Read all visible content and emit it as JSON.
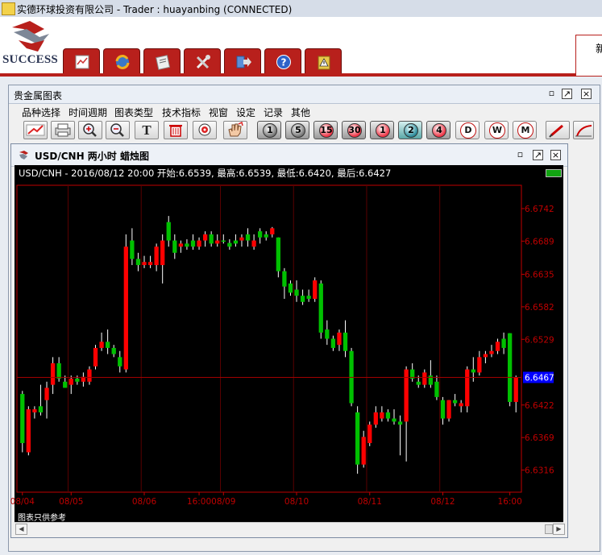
{
  "app": {
    "title": "实德环球投资有限公司 -  Trader : huayanbing (CONNECTED)",
    "logo_text": "SUCCESS",
    "right_box_text": "新"
  },
  "main_tabs": [
    {
      "icon": "chart-doc-icon"
    },
    {
      "icon": "refresh-globe-icon"
    },
    {
      "icon": "notes-icon"
    },
    {
      "icon": "tools-icon"
    },
    {
      "icon": "exit-icon"
    },
    {
      "icon": "help-icon"
    },
    {
      "icon": "clipboard-alert-icon"
    }
  ],
  "chart_window": {
    "title": "贵金属图表",
    "menu": [
      "品种选择",
      "时间週期",
      "图表类型",
      "技术指标",
      "视窗",
      "设定",
      "记录",
      "其他"
    ],
    "toolbar": [
      {
        "icon": "drawing-line-icon"
      },
      {
        "icon": "print-icon"
      },
      {
        "icon": "zoom-in-icon"
      },
      {
        "icon": "zoom-out-icon"
      },
      {
        "icon": "text-tool-icon",
        "glyph": "T"
      },
      {
        "icon": "delete-icon"
      },
      {
        "icon": "target-icon"
      },
      {
        "icon": "hand-icon"
      }
    ],
    "periods": [
      "1",
      "5",
      "15",
      "30",
      "1",
      "2",
      "4",
      "D",
      "W",
      "M"
    ]
  },
  "sub_window": {
    "title": "USD/CNH 两小时 蜡烛图",
    "info": "USD/CNH - 2016/08/12 20:00 开始:6.6539, 最高:6.6539, 最低:6.6420, 最后:6.6427",
    "disclaimer": "图表只供参考"
  },
  "colors": {
    "up": "#ff0000",
    "down": "#00c000",
    "axis": "#c00000",
    "grid": "#5a0000",
    "current_bg": "#0000ff",
    "accent": "#b8201c"
  },
  "chart_data": {
    "type": "candlestick",
    "symbol": "USD/CNH",
    "ylim": [
      6.628,
      6.678
    ],
    "yticks": [
      6.6742,
      6.6689,
      6.6635,
      6.6582,
      6.6529,
      6.6467,
      6.6422,
      6.6369,
      6.6316
    ],
    "current_price": 6.6467,
    "xticks": [
      "08/04",
      "08/05",
      "08/06",
      "16:00",
      "08/09",
      "08/10",
      "08/11",
      "08/12",
      "16:00"
    ],
    "candles": [
      {
        "o": 6.644,
        "h": 6.6445,
        "l": 6.6345,
        "c": 6.636
      },
      {
        "o": 6.6345,
        "h": 6.642,
        "l": 6.634,
        "c": 6.6415
      },
      {
        "o": 6.641,
        "h": 6.642,
        "l": 6.64,
        "c": 6.6415
      },
      {
        "o": 6.642,
        "h": 6.6455,
        "l": 6.6405,
        "c": 6.641
      },
      {
        "o": 6.643,
        "h": 6.646,
        "l": 6.64,
        "c": 6.645
      },
      {
        "o": 6.6455,
        "h": 6.65,
        "l": 6.644,
        "c": 6.649
      },
      {
        "o": 6.649,
        "h": 6.65,
        "l": 6.646,
        "c": 6.6465
      },
      {
        "o": 6.646,
        "h": 6.647,
        "l": 6.645,
        "c": 6.645
      },
      {
        "o": 6.6455,
        "h": 6.647,
        "l": 6.644,
        "c": 6.6465
      },
      {
        "o": 6.6465,
        "h": 6.647,
        "l": 6.6455,
        "c": 6.646
      },
      {
        "o": 6.646,
        "h": 6.6475,
        "l": 6.6452,
        "c": 6.6468
      },
      {
        "o": 6.646,
        "h": 6.6485,
        "l": 6.6455,
        "c": 6.648
      },
      {
        "o": 6.6485,
        "h": 6.652,
        "l": 6.648,
        "c": 6.6515
      },
      {
        "o": 6.6515,
        "h": 6.654,
        "l": 6.651,
        "c": 6.6525
      },
      {
        "o": 6.6525,
        "h": 6.6545,
        "l": 6.6505,
        "c": 6.6515
      },
      {
        "o": 6.6515,
        "h": 6.652,
        "l": 6.65,
        "c": 6.6505
      },
      {
        "o": 6.65,
        "h": 6.651,
        "l": 6.6475,
        "c": 6.6485
      },
      {
        "o": 6.648,
        "h": 6.67,
        "l": 6.6475,
        "c": 6.668
      },
      {
        "o": 6.669,
        "h": 6.671,
        "l": 6.665,
        "c": 6.666
      },
      {
        "o": 6.666,
        "h": 6.667,
        "l": 6.664,
        "c": 6.665
      },
      {
        "o": 6.665,
        "h": 6.6665,
        "l": 6.6645,
        "c": 6.6655
      },
      {
        "o": 6.665,
        "h": 6.6665,
        "l": 6.6645,
        "c": 6.6655
      },
      {
        "o": 6.665,
        "h": 6.6685,
        "l": 6.664,
        "c": 6.668
      },
      {
        "o": 6.665,
        "h": 6.67,
        "l": 6.662,
        "c": 6.669
      },
      {
        "o": 6.672,
        "h": 6.673,
        "l": 6.668,
        "c": 6.669
      },
      {
        "o": 6.669,
        "h": 6.67,
        "l": 6.666,
        "c": 6.667
      },
      {
        "o": 6.668,
        "h": 6.669,
        "l": 6.667,
        "c": 6.6685
      },
      {
        "o": 6.6685,
        "h": 6.6692,
        "l": 6.6675,
        "c": 6.668
      },
      {
        "o": 6.669,
        "h": 6.67,
        "l": 6.6675,
        "c": 6.668
      },
      {
        "o": 6.668,
        "h": 6.6695,
        "l": 6.6675,
        "c": 6.669
      },
      {
        "o": 6.669,
        "h": 6.6705,
        "l": 6.668,
        "c": 6.67
      },
      {
        "o": 6.67,
        "h": 6.6705,
        "l": 6.668,
        "c": 6.6685
      },
      {
        "o": 6.6685,
        "h": 6.67,
        "l": 6.668,
        "c": 6.669
      },
      {
        "o": 6.669,
        "h": 6.67,
        "l": 6.6685,
        "c": 6.6688
      },
      {
        "o": 6.6686,
        "h": 6.6692,
        "l": 6.6675,
        "c": 6.668
      },
      {
        "o": 6.669,
        "h": 6.67,
        "l": 6.668,
        "c": 6.6685
      },
      {
        "o": 6.669,
        "h": 6.67,
        "l": 6.668,
        "c": 6.6695
      },
      {
        "o": 6.67,
        "h": 6.671,
        "l": 6.668,
        "c": 6.669
      },
      {
        "o": 6.668,
        "h": 6.67,
        "l": 6.6675,
        "c": 6.669
      },
      {
        "o": 6.6705,
        "h": 6.671,
        "l": 6.6685,
        "c": 6.6695
      },
      {
        "o": 6.67,
        "h": 6.6705,
        "l": 6.669,
        "c": 6.6695
      },
      {
        "o": 6.67,
        "h": 6.6712,
        "l": 6.6695,
        "c": 6.671
      },
      {
        "o": 6.6695,
        "h": 6.6695,
        "l": 6.663,
        "c": 6.664
      },
      {
        "o": 6.664,
        "h": 6.6645,
        "l": 6.6595,
        "c": 6.6615
      },
      {
        "o": 6.662,
        "h": 6.6625,
        "l": 6.66,
        "c": 6.6605
      },
      {
        "o": 6.661,
        "h": 6.6625,
        "l": 6.659,
        "c": 6.66
      },
      {
        "o": 6.66,
        "h": 6.661,
        "l": 6.6585,
        "c": 6.659
      },
      {
        "o": 6.66,
        "h": 6.661,
        "l": 6.659,
        "c": 6.6595
      },
      {
        "o": 6.6595,
        "h": 6.663,
        "l": 6.659,
        "c": 6.6625
      },
      {
        "o": 6.662,
        "h": 6.6625,
        "l": 6.653,
        "c": 6.654
      },
      {
        "o": 6.6545,
        "h": 6.656,
        "l": 6.652,
        "c": 6.653
      },
      {
        "o": 6.653,
        "h": 6.6535,
        "l": 6.651,
        "c": 6.6515
      },
      {
        "o": 6.652,
        "h": 6.6545,
        "l": 6.651,
        "c": 6.654
      },
      {
        "o": 6.654,
        "h": 6.656,
        "l": 6.65,
        "c": 6.651
      },
      {
        "o": 6.651,
        "h": 6.6515,
        "l": 6.642,
        "c": 6.6425
      },
      {
        "o": 6.641,
        "h": 6.642,
        "l": 6.631,
        "c": 6.6325
      },
      {
        "o": 6.6325,
        "h": 6.638,
        "l": 6.632,
        "c": 6.637
      },
      {
        "o": 6.636,
        "h": 6.6395,
        "l": 6.6355,
        "c": 6.639
      },
      {
        "o": 6.639,
        "h": 6.642,
        "l": 6.6385,
        "c": 6.641
      },
      {
        "o": 6.64,
        "h": 6.642,
        "l": 6.6395,
        "c": 6.641
      },
      {
        "o": 6.641,
        "h": 6.6415,
        "l": 6.6395,
        "c": 6.64
      },
      {
        "o": 6.64,
        "h": 6.6415,
        "l": 6.639,
        "c": 6.6395
      },
      {
        "o": 6.6395,
        "h": 6.6405,
        "l": 6.634,
        "c": 6.639
      },
      {
        "o": 6.6395,
        "h": 6.6485,
        "l": 6.633,
        "c": 6.648
      },
      {
        "o": 6.648,
        "h": 6.649,
        "l": 6.646,
        "c": 6.6465
      },
      {
        "o": 6.646,
        "h": 6.647,
        "l": 6.645,
        "c": 6.6455
      },
      {
        "o": 6.6455,
        "h": 6.648,
        "l": 6.645,
        "c": 6.6475
      },
      {
        "o": 6.647,
        "h": 6.6495,
        "l": 6.645,
        "c": 6.6455
      },
      {
        "o": 6.646,
        "h": 6.647,
        "l": 6.643,
        "c": 6.6435
      },
      {
        "o": 6.643,
        "h": 6.6435,
        "l": 6.639,
        "c": 6.64
      },
      {
        "o": 6.64,
        "h": 6.643,
        "l": 6.6395,
        "c": 6.643
      },
      {
        "o": 6.643,
        "h": 6.644,
        "l": 6.642,
        "c": 6.6425
      },
      {
        "o": 6.642,
        "h": 6.643,
        "l": 6.641,
        "c": 6.6425
      },
      {
        "o": 6.642,
        "h": 6.6485,
        "l": 6.641,
        "c": 6.648
      },
      {
        "o": 6.648,
        "h": 6.65,
        "l": 6.646,
        "c": 6.6475
      },
      {
        "o": 6.6475,
        "h": 6.651,
        "l": 6.647,
        "c": 6.65
      },
      {
        "o": 6.65,
        "h": 6.651,
        "l": 6.649,
        "c": 6.6505
      },
      {
        "o": 6.6505,
        "h": 6.652,
        "l": 6.65,
        "c": 6.651
      },
      {
        "o": 6.651,
        "h": 6.653,
        "l": 6.6505,
        "c": 6.6525
      },
      {
        "o": 6.653,
        "h": 6.654,
        "l": 6.6505,
        "c": 6.6515
      },
      {
        "o": 6.6539,
        "h": 6.6539,
        "l": 6.642,
        "c": 6.6427
      },
      {
        "o": 6.6427,
        "h": 6.647,
        "l": 6.641,
        "c": 6.6467
      }
    ]
  }
}
